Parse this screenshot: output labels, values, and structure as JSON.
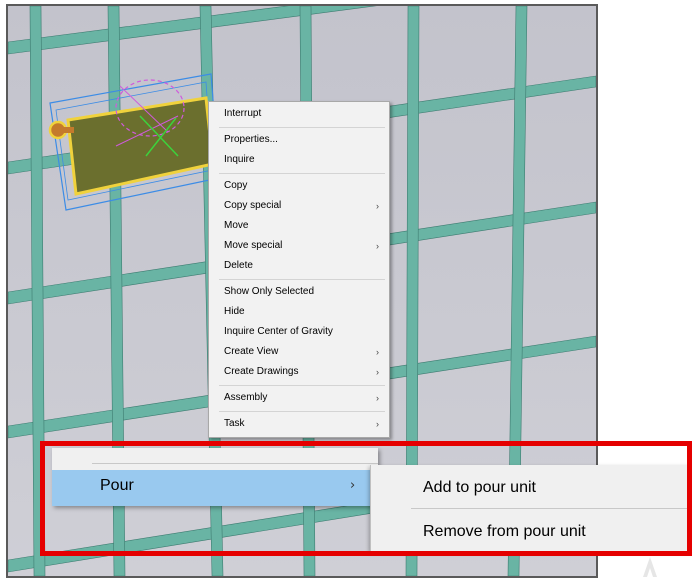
{
  "context_menu": {
    "groups": [
      [
        {
          "label": "Interrupt",
          "submenu": false
        }
      ],
      [
        {
          "label": "Properties...",
          "submenu": false
        },
        {
          "label": "Inquire",
          "submenu": false
        }
      ],
      [
        {
          "label": "Copy",
          "submenu": false
        },
        {
          "label": "Copy special",
          "submenu": true
        },
        {
          "label": "Move",
          "submenu": false
        },
        {
          "label": "Move special",
          "submenu": true
        },
        {
          "label": "Delete",
          "submenu": false
        }
      ],
      [
        {
          "label": "Show Only Selected",
          "submenu": false
        },
        {
          "label": "Hide",
          "submenu": false
        },
        {
          "label": "Inquire Center of Gravity",
          "submenu": false
        },
        {
          "label": "Create View",
          "submenu": true
        },
        {
          "label": "Create Drawings",
          "submenu": true
        }
      ],
      [
        {
          "label": "Assembly",
          "submenu": true
        }
      ],
      [
        {
          "label": "Task",
          "submenu": true
        }
      ]
    ],
    "arrow_glyph": "›"
  },
  "zoom_menu": {
    "pour_label": "Pour",
    "pour_arrow": "›"
  },
  "submenu": {
    "add_label": "Add to pour unit",
    "remove_label": "Remove from pour unit"
  },
  "colors": {
    "grid_line": "#69b4a4",
    "selection_box": "#3c8ce6",
    "part_fill": "#6b6f2e",
    "highlight": "#f0d23c",
    "dim_magenta": "#d05adc",
    "axis_green": "#3cd23c",
    "pour_highlight": "#99c9ef",
    "frame_red": "#e50000"
  }
}
